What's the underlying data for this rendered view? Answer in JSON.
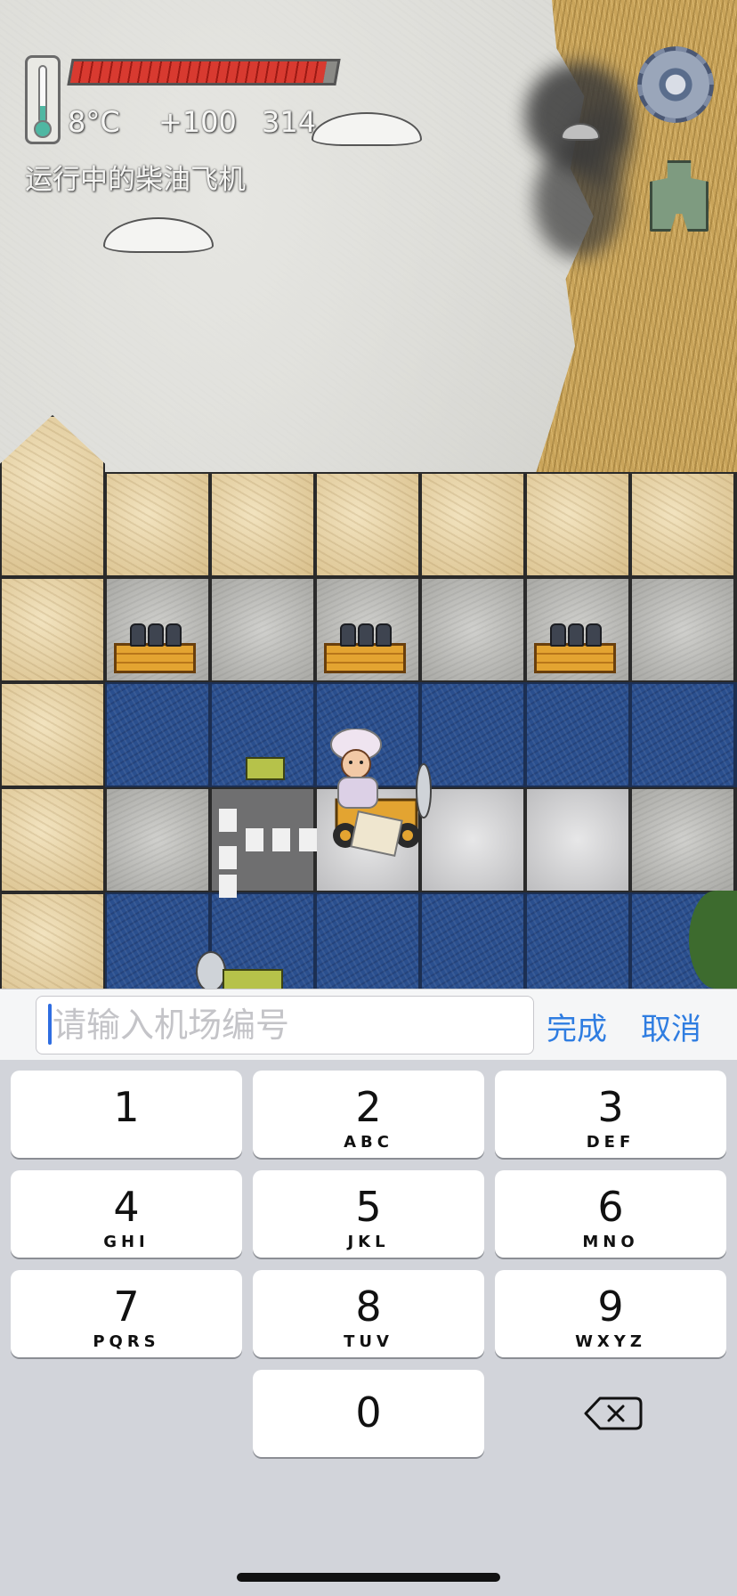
{
  "hud": {
    "temperature": "8°C",
    "bonus": "+100",
    "score": "314",
    "health_fraction": 0.96,
    "status": "运行中的柴油飞机"
  },
  "icons": {
    "settings": "gear-icon",
    "map": "map-icon",
    "thermometer": "thermometer-icon",
    "backspace": "backspace-icon"
  },
  "input_bar": {
    "placeholder": "请输入机场编号",
    "value": "",
    "done_label": "完成",
    "cancel_label": "取消",
    "accent_color": "#2f7de1"
  },
  "keypad": {
    "keys": [
      {
        "digit": "1",
        "letters": ""
      },
      {
        "digit": "2",
        "letters": "ABC"
      },
      {
        "digit": "3",
        "letters": "DEF"
      },
      {
        "digit": "4",
        "letters": "GHI"
      },
      {
        "digit": "5",
        "letters": "JKL"
      },
      {
        "digit": "6",
        "letters": "MNO"
      },
      {
        "digit": "7",
        "letters": "PQRS"
      },
      {
        "digit": "8",
        "letters": "TUV"
      },
      {
        "digit": "9",
        "letters": "WXYZ"
      },
      {
        "digit": "0",
        "letters": ""
      }
    ]
  }
}
